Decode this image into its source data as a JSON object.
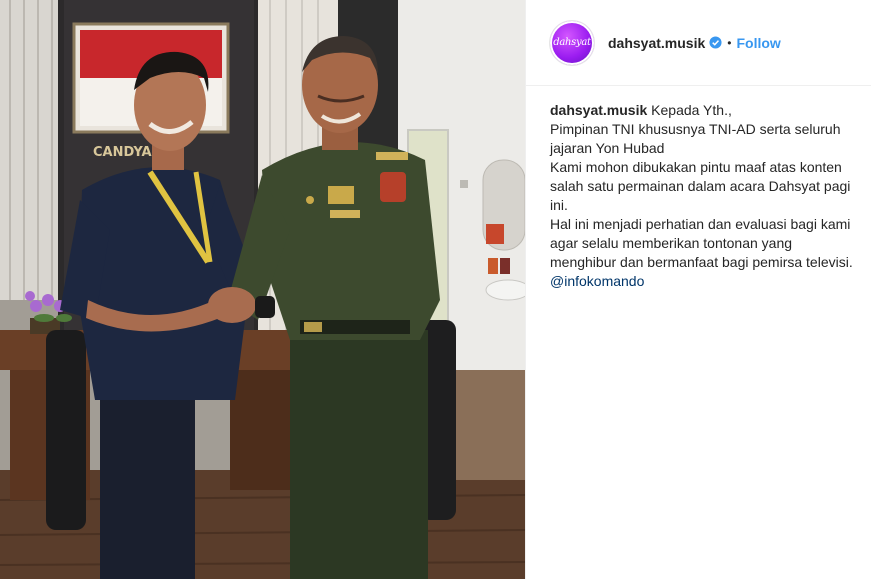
{
  "post": {
    "username": "dahsyat.musik",
    "avatar_text": "dahsyat",
    "verified_icon": "verified-badge-icon",
    "separator": "•",
    "follow_label": "Follow"
  },
  "caption": {
    "username": "dahsyat.musik",
    "lines": [
      "Kepada Yth.,",
      "Pimpinan TNI khususnya TNI-AD serta seluruh jajaran Yon Hubad",
      "Kami mohon dibukakan pintu maaf atas konten salah satu permainan dalam acara Dahsyat pagi ini.",
      "Hal ini menjadi perhatian dan evaluasi bagi kami agar selalu memberikan tontonan yang menghibur dan bermanfaat bagi pemirsa televisi. "
    ],
    "mention": "@infokomando"
  },
  "photo": {
    "sign_text": "CANDYA             MA",
    "colors": {
      "flag_red": "#c8272c",
      "uniform_green": "#3d4a2e",
      "shirt_navy": "#1d2740"
    }
  },
  "colors": {
    "accent": "#3897f0",
    "text": "#262626",
    "border": "#efefef"
  }
}
